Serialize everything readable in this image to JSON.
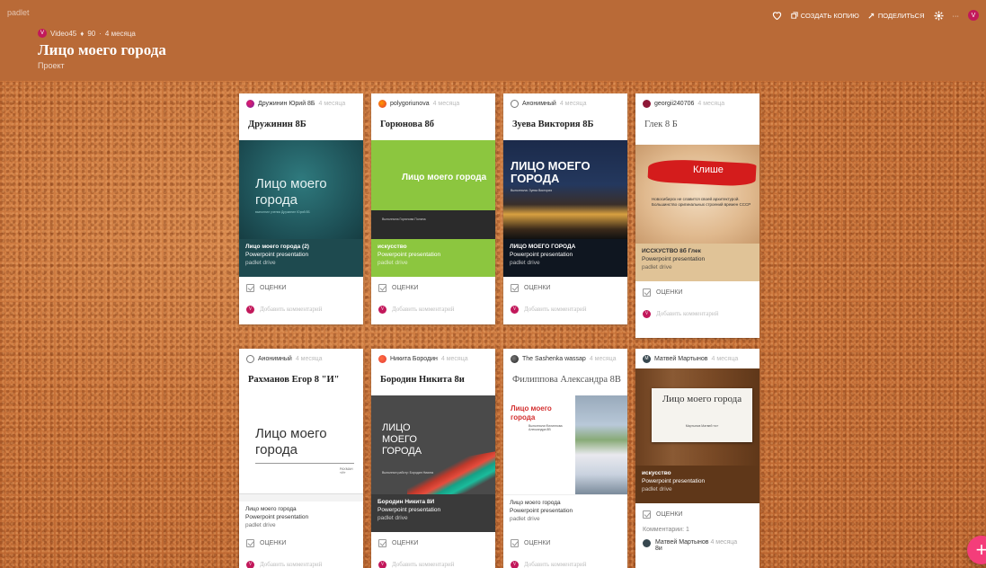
{
  "header": {
    "brand": "padlet",
    "author": "Video45",
    "author_initial": "V",
    "likes": "90",
    "age": "4 месяца",
    "title": "Лицо моего города",
    "subtitle": "Проект",
    "actions": {
      "copy": "создать копию",
      "share": "поделиться"
    },
    "user_initial": "V"
  },
  "rating_label": "оценки",
  "comment_placeholder": "Добавить комментарий",
  "cards": [
    {
      "author": "Дружинин Юрий 8Б",
      "time": "4 месяца",
      "title": "Дружинин 8Б",
      "slide_title": "Лицо моего города",
      "slide_sub": "выполнил ученик Дружинин Юрий 8Б",
      "file_name": "Лицо моего города (2)",
      "file_type": "Powerpoint presentation",
      "file_source": "padlet drive"
    },
    {
      "author": "polygoriunova",
      "time": "4 месяца",
      "title": "Горюнова 8б",
      "slide_title": "Лицо моего города",
      "slide_sub": "Выполнила Горюнова Полина",
      "file_name": "искусство",
      "file_type": "Powerpoint presentation",
      "file_source": "padlet drive"
    },
    {
      "author": "Анонимный",
      "time": "4 месяца",
      "title": "Зуева Виктория 8Б",
      "slide_title": "ЛИЦО МОЕГО ГОРОДА",
      "slide_sub": "Выполнила: Зуева Виктория",
      "file_name": "ЛИЦО МОЕГО ГОРОДА",
      "file_type": "Powerpoint presentation",
      "file_source": "padlet drive"
    },
    {
      "author": "georgii240706",
      "time": "4 месяца",
      "title": "Глек 8 Б",
      "slide_title": "Клише",
      "slide_sub": "Новосибирск не славится своей архитектурой. Большинство оригинальных строений времен СССР",
      "file_name": "ИССКУСТВО 8б Глек",
      "file_type": "Powerpoint presentation",
      "file_source": "padlet drive"
    },
    {
      "author": "Анонимный",
      "time": "4 месяца",
      "title": "Рахманов Егор 8 \"И\"",
      "slide_title": "Лицо моего города",
      "slide_sub": "РАХМАН «И»",
      "file_name": "Лицо моего города",
      "file_type": "Powerpoint presentation",
      "file_source": "padlet drive"
    },
    {
      "author": "Никита Бородин",
      "time": "4 месяца",
      "title": "Бородин Никита 8и",
      "slide_title": "ЛИЦО МОЕГО ГОРОДА",
      "slide_sub": "Выполнил работу: Бородин Никита",
      "file_name": "Бородин Никита 8И",
      "file_type": "Powerpoint presentation",
      "file_source": "padlet drive"
    },
    {
      "author": "The Sashenka wassap",
      "time": "4 месяца",
      "title": "Филиппова Александра 8В",
      "slide_title": "Лицо моего города",
      "slide_sub": "Выполнила Филиппова Александра 8В",
      "file_name": "Лицо моего города",
      "file_type": "Powerpoint presentation",
      "file_source": "padlet drive"
    },
    {
      "author": "Матвей Мартынов",
      "time": "4 месяца",
      "title": "",
      "slide_title": "Лицо моего города",
      "slide_sub": "Мартынов Матвей «и»",
      "file_name": "искусство",
      "file_type": "Powerpoint presentation",
      "file_source": "padlet drive",
      "comments_count": "Комментарии: 1",
      "comment_author": "Матвей Мартынов",
      "comment_time": "4 месяца",
      "comment_text": "8и"
    }
  ]
}
